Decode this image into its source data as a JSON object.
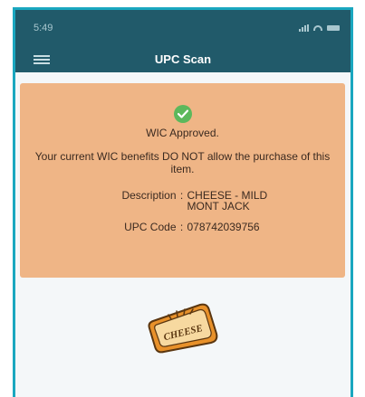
{
  "status_bar": {
    "time": "5:49"
  },
  "nav": {
    "title": "UPC Scan"
  },
  "notice": {
    "status": "WIC Approved.",
    "message": "Your current WIC benefits DO NOT allow the purchase of this item.",
    "description_label": "Description",
    "description_value": "CHEESE - MILD MONT JACK",
    "upc_label": "UPC Code",
    "upc_value": "078742039756",
    "separator": ":"
  },
  "product_image": {
    "label": "CHEESE"
  },
  "colors": {
    "header": "#215a6a",
    "notice_background": "#efb586",
    "success": "#5cb85c",
    "frame_border": "#1aa7bf"
  },
  "icons": [
    "hamburger-menu-icon",
    "check-circle-icon",
    "cellular-signal-icon",
    "wifi-icon",
    "battery-icon"
  ]
}
